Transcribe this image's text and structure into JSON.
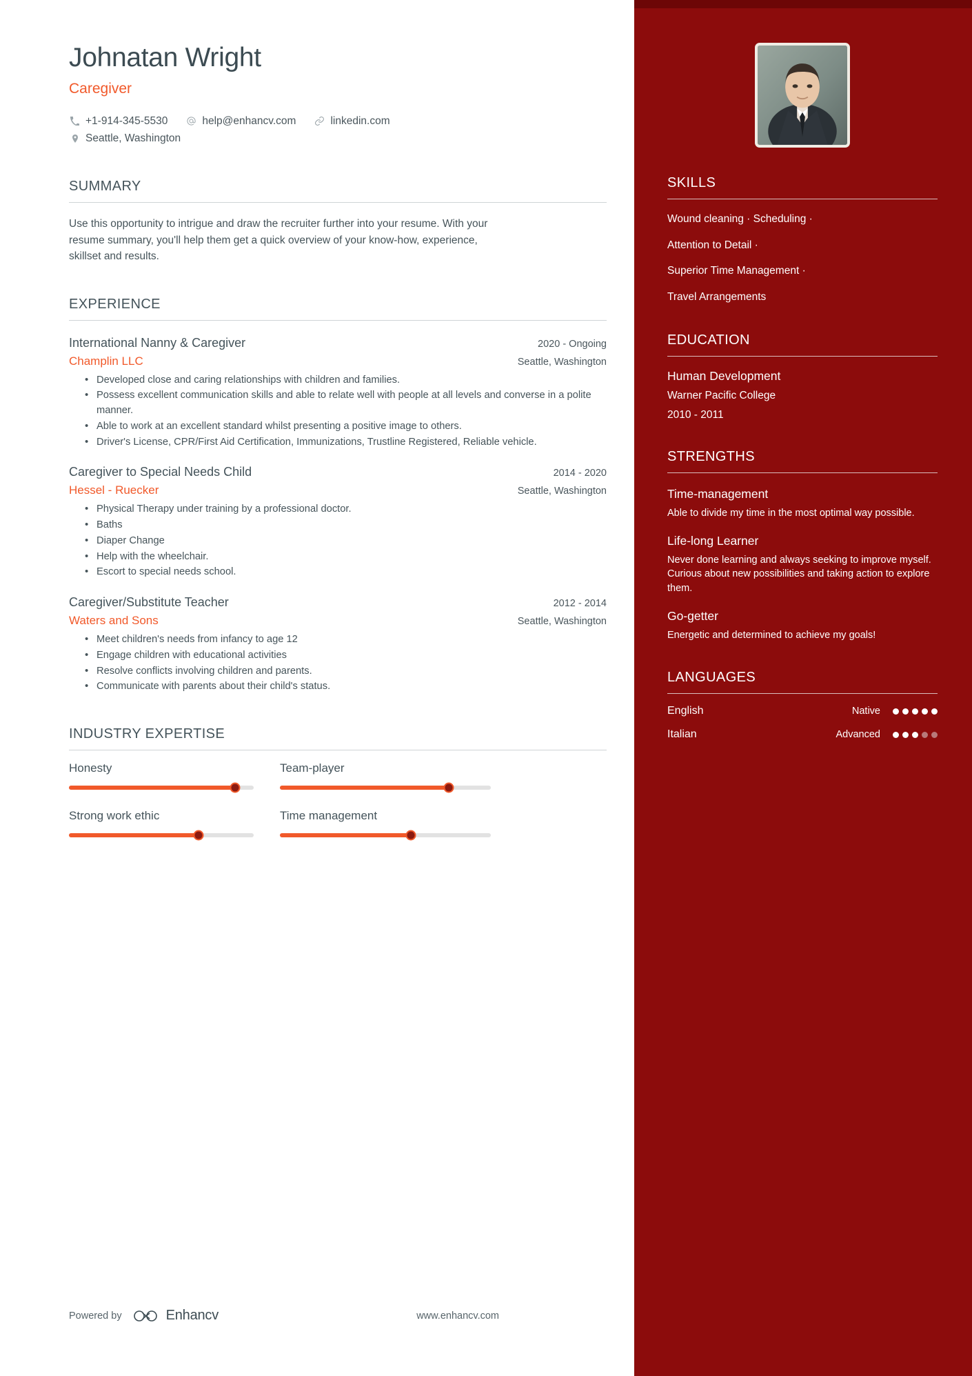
{
  "header": {
    "name": "Johnatan Wright",
    "title": "Caregiver",
    "contacts": {
      "phone": "+1-914-345-5530",
      "email": "help@enhancv.com",
      "link": "linkedin.com",
      "location": "Seattle, Washington"
    }
  },
  "summary": {
    "title": "SUMMARY",
    "text": "Use this opportunity to intrigue and draw the recruiter further into your resume. With your resume summary, you'll help them get a quick overview of your know-how, experience, skillset and results."
  },
  "experience": {
    "title": "EXPERIENCE",
    "jobs": [
      {
        "position": "International Nanny & Caregiver",
        "date": "2020 - Ongoing",
        "company": "Champlin LLC",
        "location": "Seattle, Washington",
        "bullets": [
          "Developed close and caring relationships with children and families.",
          "Possess excellent communication skills and able to relate well with people at all levels and converse in a polite manner.",
          "Able to work at an excellent standard whilst presenting a positive image to others.",
          "Driver's License, CPR/First Aid Certification, Immunizations, Trustline Registered, Reliable vehicle."
        ]
      },
      {
        "position": "Caregiver to Special Needs Child",
        "date": "2014 - 2020",
        "company": "Hessel - Ruecker",
        "location": "Seattle, Washington",
        "bullets": [
          "Physical Therapy under training by a professional doctor.",
          " Baths",
          "Diaper Change",
          "Help with the wheelchair.",
          "Escort to special needs school."
        ]
      },
      {
        "position": "Caregiver/Substitute Teacher",
        "date": "2012 - 2014",
        "company": "Waters and Sons",
        "location": "Seattle, Washington",
        "bullets": [
          "Meet children's needs from infancy to age 12",
          "Engage children with educational activities",
          "Resolve conflicts involving children and parents.",
          "Communicate with parents about their child's status."
        ]
      }
    ]
  },
  "industry_expertise": {
    "title": "INDUSTRY EXPERTISE",
    "items": [
      {
        "label": "Honesty",
        "value": 90
      },
      {
        "label": "Team-player",
        "value": 80
      },
      {
        "label": "Strong work ethic",
        "value": 70
      },
      {
        "label": "Time management",
        "value": 62
      }
    ]
  },
  "footer": {
    "powered_by": "Powered by",
    "brand": "Enhancv",
    "url": "www.enhancv.com"
  },
  "sidebar": {
    "skills": {
      "title": "SKILLS",
      "lines": [
        "Wound cleaning · Scheduling ·",
        "Attention to Detail ·",
        "Superior Time Management ·",
        "Travel Arrangements"
      ]
    },
    "education": {
      "title": "EDUCATION",
      "degree": "Human Development",
      "school": "Warner Pacific College",
      "dates": "2010 - 2011"
    },
    "strengths": {
      "title": "STRENGTHS",
      "items": [
        {
          "name": "Time-management",
          "description": "Able to divide my time in the most optimal way possible."
        },
        {
          "name": "Life-long Learner",
          "description": "Never done learning and always seeking to improve myself. Curious about new possibilities and taking action to explore them."
        },
        {
          "name": "Go-getter",
          "description": "Energetic and determined to achieve my goals!"
        }
      ]
    },
    "languages": {
      "title": "LANGUAGES",
      "items": [
        {
          "name": "English",
          "level": "Native",
          "rating": 5,
          "max": 5
        },
        {
          "name": "Italian",
          "level": "Advanced",
          "rating": 3,
          "max": 5
        }
      ]
    }
  },
  "colors": {
    "accent": "#f1592a",
    "sidebar_bg": "#8c0c0c",
    "sidebar_top": "#6d0606",
    "text": "#46545a"
  }
}
